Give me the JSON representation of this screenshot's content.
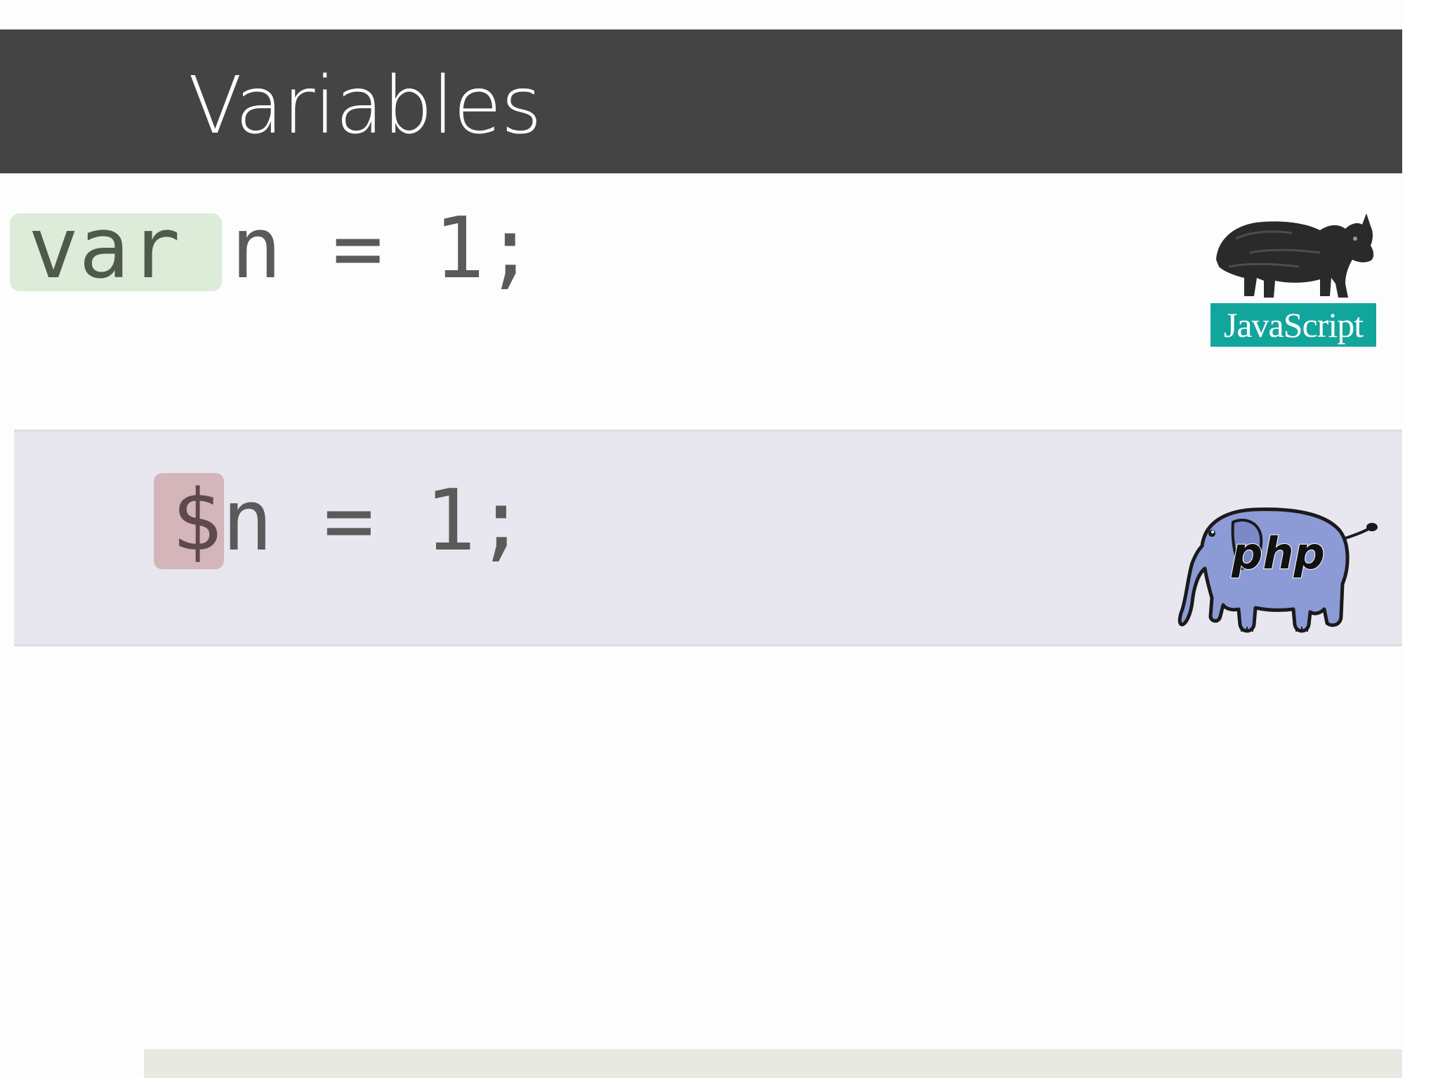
{
  "slide": {
    "title": "Variables"
  },
  "code": {
    "js": {
      "keyword": "var ",
      "rest": "n = 1;"
    },
    "php": {
      "sigil": "$",
      "rest": "n = 1;"
    }
  },
  "logos": {
    "js": {
      "label": "JavaScript",
      "icon": "rhino-icon",
      "color": "#12a59c"
    },
    "php": {
      "label": "php",
      "icon": "elephant-icon",
      "color": "#8892bf"
    }
  },
  "highlights": {
    "var_color": "#dcecd9",
    "dollar_color": "#d4b6ba"
  }
}
